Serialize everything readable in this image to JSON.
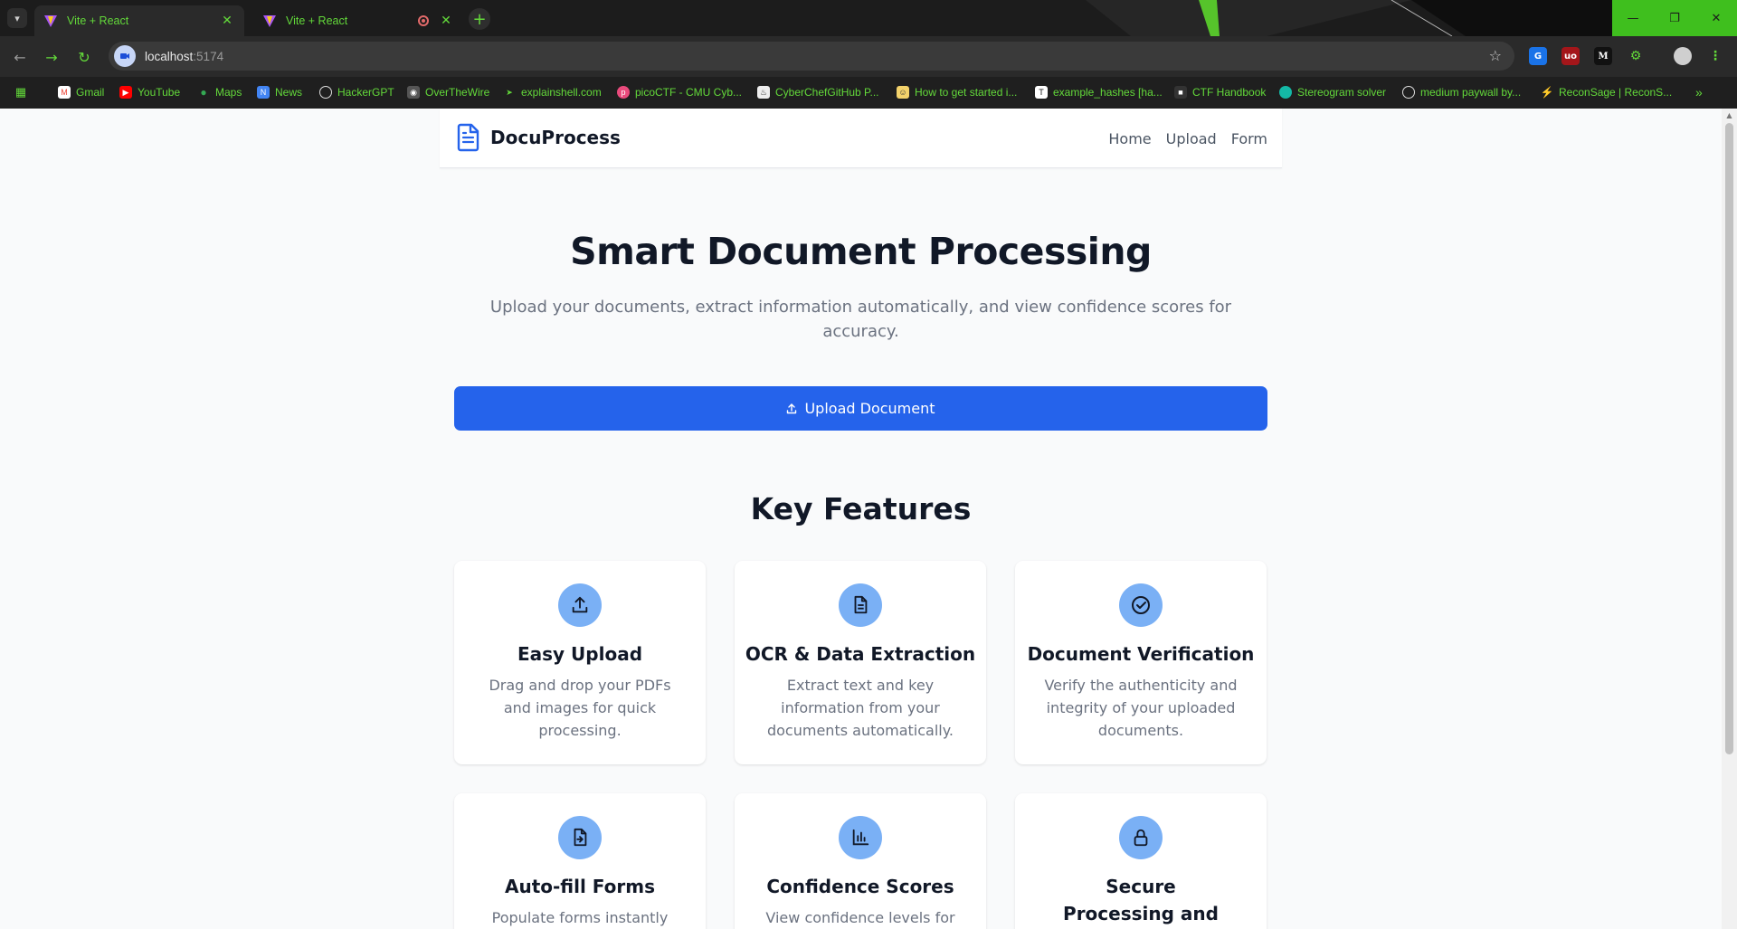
{
  "browser": {
    "tabs": [
      {
        "title": "Vite + React",
        "active": true
      },
      {
        "title": "Vite + React",
        "active": false
      }
    ],
    "url_host": "localhost",
    "url_port": ":5174",
    "bookmarks": [
      {
        "label": "Gmail",
        "icon": "gmail-icon"
      },
      {
        "label": "YouTube",
        "icon": "youtube-icon"
      },
      {
        "label": "Maps",
        "icon": "maps-icon"
      },
      {
        "label": "News",
        "icon": "news-icon"
      },
      {
        "label": "HackerGPT",
        "icon": "globe-icon"
      },
      {
        "label": "OverTheWire",
        "icon": "overthewire-icon"
      },
      {
        "label": "explainshell.com",
        "icon": "shell-icon"
      },
      {
        "label": "picoCTF - CMU Cyb...",
        "icon": "picoctf-icon"
      },
      {
        "label": "CyberChefGitHub P...",
        "icon": "chef-icon"
      },
      {
        "label": "How to get started i...",
        "icon": "face-icon"
      },
      {
        "label": "example_hashes [ha...",
        "icon": "text-icon"
      },
      {
        "label": "CTF Handbook",
        "icon": "book-icon"
      },
      {
        "label": "Stereogram solver",
        "icon": "circle-icon"
      },
      {
        "label": "medium paywall by...",
        "icon": "globe-icon"
      },
      {
        "label": "ReconSage | ReconS...",
        "icon": "bolt-icon"
      }
    ]
  },
  "app": {
    "brand": "DocuProcess",
    "nav": {
      "home": "Home",
      "upload": "Upload",
      "form": "Form"
    },
    "hero": {
      "title": "Smart Document Processing",
      "subtitle": "Upload your documents, extract information automatically, and view confidence scores for accuracy.",
      "cta": "Upload Document"
    },
    "features_title": "Key Features",
    "features": [
      {
        "title": "Easy Upload",
        "desc": "Drag and drop your PDFs and images for quick processing.",
        "icon": "upload-icon"
      },
      {
        "title": "OCR & Data Extraction",
        "desc": "Extract text and key information from your documents automatically.",
        "icon": "document-icon"
      },
      {
        "title": "Document Verification",
        "desc": "Verify the authenticity and integrity of your uploaded documents.",
        "icon": "check-circle-icon"
      },
      {
        "title": "Auto-fill Forms",
        "desc": "Populate forms instantly",
        "icon": "file-import-icon"
      },
      {
        "title": "Confidence Scores",
        "desc": "View confidence levels for",
        "icon": "bar-chart-icon"
      },
      {
        "title": "Secure Processing and Storage",
        "desc": "",
        "icon": "lock-icon"
      }
    ]
  },
  "colors": {
    "primary": "#2563eb",
    "icon_bg": "#7ab0f5",
    "text_dark": "#111827",
    "text_muted": "#6b7280",
    "chrome_accent": "#63d93a"
  }
}
